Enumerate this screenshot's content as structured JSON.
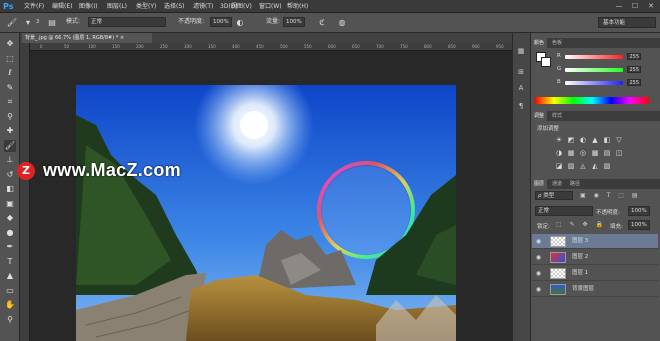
{
  "app": {
    "logo": "Ps"
  },
  "menu": [
    "文件(F)",
    "编辑(E)",
    "图像(I)",
    "图层(L)",
    "类型(Y)",
    "选择(S)",
    "滤镜(T)",
    "3D(D)",
    "视图(V)",
    "窗口(W)",
    "帮助(H)"
  ],
  "window_controls": {
    "minimize": "—",
    "maximize": "☐",
    "close": "✕"
  },
  "options": {
    "brush_size": "3",
    "mode_label": "模式:",
    "mode_value": "正常",
    "opacity_label": "不透明度:",
    "opacity_value": "100%",
    "flow_label": "流量:",
    "flow_value": "100%",
    "workspace": "基本功能"
  },
  "document": {
    "tab_title": "背景_.jpg @ 66.7% (图层 1, RGB/8#) * ×"
  },
  "ruler_ticks": [
    "0",
    "50",
    "100",
    "150",
    "200",
    "250",
    "300",
    "350",
    "400",
    "450",
    "500",
    "550",
    "600",
    "650",
    "700",
    "750",
    "800",
    "850",
    "900",
    "950"
  ],
  "watermark": {
    "badge": "Z",
    "text": "www.MacZ.com"
  },
  "color_panel": {
    "tabs": [
      "颜色",
      "色板"
    ],
    "channels": [
      {
        "label": "R",
        "value": "255",
        "color": "#ff2020"
      },
      {
        "label": "G",
        "value": "255",
        "color": "#20ff20"
      },
      {
        "label": "B",
        "value": "255",
        "color": "#2020ff"
      }
    ]
  },
  "adjust_panel": {
    "tabs": [
      "调整",
      "样式"
    ],
    "title": "添加调整"
  },
  "layers_panel": {
    "tabs": [
      "图层",
      "通道",
      "路径"
    ],
    "kind_label": "ρ 类型",
    "blend_mode": "正常",
    "opacity_label": "不透明度:",
    "opacity_value": "100%",
    "lock_label": "锁定:",
    "fill_label": "填充:",
    "fill_value": "100%",
    "layers": [
      {
        "name": "图层 3",
        "selected": true
      },
      {
        "name": "图层 2",
        "selected": false
      },
      {
        "name": "图层 1",
        "selected": false
      },
      {
        "name": "背景图层",
        "selected": false
      }
    ]
  },
  "colors": {
    "accent": "#31a8ff",
    "selection": "#6b7b95",
    "panel": "#535353"
  }
}
